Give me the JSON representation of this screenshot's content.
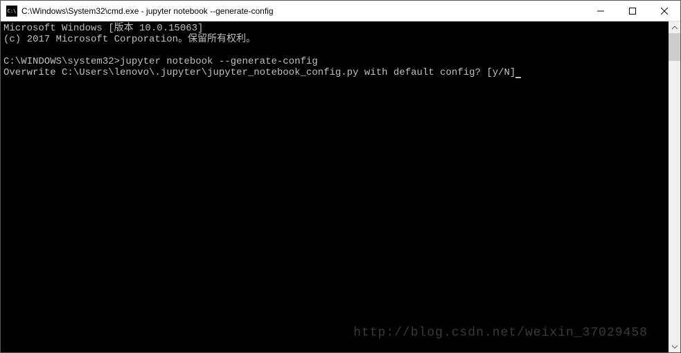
{
  "titlebar": {
    "title": "C:\\Windows\\System32\\cmd.exe - jupyter  notebook --generate-config"
  },
  "terminal": {
    "line1": "Microsoft Windows [版本 10.0.15063]",
    "line2": "(c) 2017 Microsoft Corporation。保留所有权利。",
    "line3": "",
    "prompt": "C:\\WINDOWS\\system32>",
    "command": "jupyter notebook --generate-config",
    "output": "Overwrite C:\\Users\\lenovo\\.jupyter\\jupyter_notebook_config.py with default config? [y/N]"
  },
  "watermark": "http://blog.csdn.net/weixin_37029458"
}
